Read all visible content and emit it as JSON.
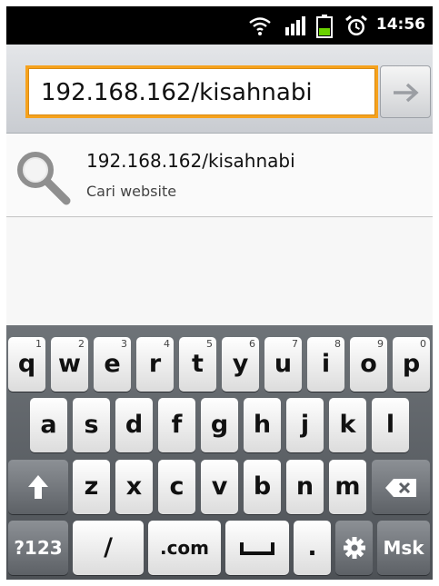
{
  "status_bar": {
    "time": "14:56",
    "icons": [
      "wifi-icon",
      "signal-icon",
      "battery-icon",
      "alarm-icon"
    ]
  },
  "url_bar": {
    "value": "192.168.162/kisahnabi",
    "go_icon": "arrow-right-icon"
  },
  "suggestion": {
    "title": "192.168.162/kisahnabi",
    "subtitle": "Cari website",
    "icon": "search-icon"
  },
  "keyboard": {
    "row1": [
      {
        "key": "q",
        "sup": "1"
      },
      {
        "key": "w",
        "sup": "2"
      },
      {
        "key": "e",
        "sup": "3"
      },
      {
        "key": "r",
        "sup": "4"
      },
      {
        "key": "t",
        "sup": "5"
      },
      {
        "key": "y",
        "sup": "6"
      },
      {
        "key": "u",
        "sup": "7"
      },
      {
        "key": "i",
        "sup": "8"
      },
      {
        "key": "o",
        "sup": "9"
      },
      {
        "key": "p",
        "sup": "0"
      }
    ],
    "row2": [
      "a",
      "s",
      "d",
      "f",
      "g",
      "h",
      "j",
      "k",
      "l"
    ],
    "row3": [
      "z",
      "x",
      "c",
      "v",
      "b",
      "n",
      "m"
    ],
    "row4": {
      "symbols": "?123",
      "slash": "/",
      "dotcom": ".com",
      "period": ".",
      "go": "Msk"
    },
    "special_icons": [
      "shift-icon",
      "backspace-icon",
      "space-icon",
      "settings-icon"
    ]
  },
  "colors": {
    "focus_border": "#f6a21d",
    "keyboard_bg": "#5c6166",
    "status_bar_bg": "#000000"
  }
}
